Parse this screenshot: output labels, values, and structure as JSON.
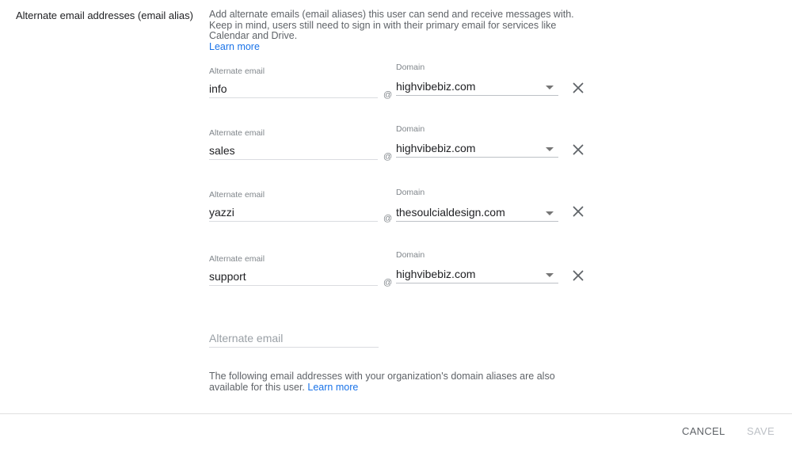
{
  "section": {
    "label": "Alternate email addresses (email alias)",
    "description": "Add alternate emails (email aliases) this user can send and receive messages with. Keep in mind, users still need to sign in with their primary email for services like Calendar and Drive.",
    "learn_more": "Learn more"
  },
  "labels": {
    "alternate_email": "Alternate email",
    "domain": "Domain",
    "at": "@"
  },
  "aliases": [
    {
      "email": "info",
      "domain": "highvibebiz.com"
    },
    {
      "email": "sales",
      "domain": "highvibebiz.com"
    },
    {
      "email": "yazzi",
      "domain": "thesoulcialdesign.com"
    },
    {
      "email": "support",
      "domain": "highvibebiz.com"
    }
  ],
  "new_alias": {
    "placeholder": "Alternate email"
  },
  "note": {
    "text": "The following email addresses with your organization's domain aliases are also available for this user.",
    "learn_more": "Learn more"
  },
  "footer": {
    "cancel": "CANCEL",
    "save": "SAVE"
  },
  "colors": {
    "link": "#1a73e8",
    "text": "#202124",
    "muted": "#5f6368",
    "disabled": "#bdc1c6"
  }
}
